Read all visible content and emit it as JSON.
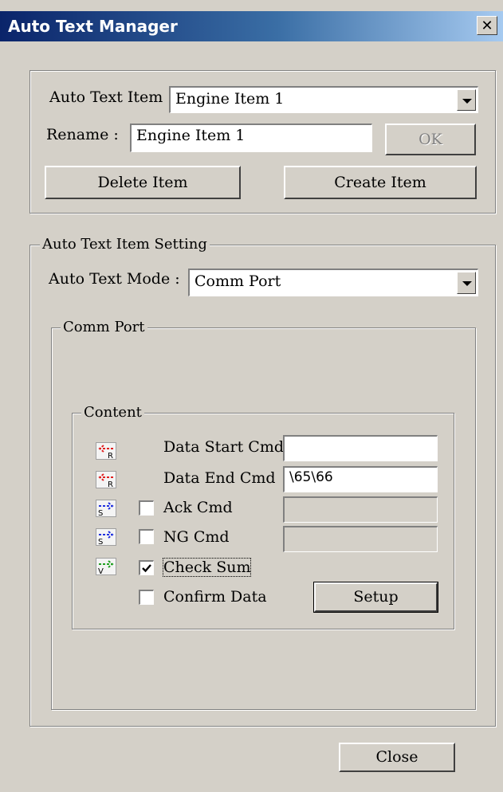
{
  "window": {
    "title": "Auto Text Manager",
    "close_glyph": "✕"
  },
  "item_group": {
    "item_label": "Auto Text Item",
    "item_selected": "Engine Item 1",
    "rename_label": "Rename :",
    "rename_value": "Engine Item 1",
    "ok_label": "OK",
    "delete_label": "Delete Item",
    "create_label": "Create Item"
  },
  "setting_group": {
    "title": "Auto Text Item Setting",
    "mode_label": "Auto Text Mode :",
    "mode_selected": "Comm Port",
    "comm_port_title": "Comm Port",
    "content": {
      "title": "Content",
      "rows": [
        {
          "label": "Data Start Cmd",
          "value": "",
          "icon": "arrow-left-R-red-icon",
          "color": "#e02020"
        },
        {
          "label": "Data End Cmd",
          "value": "\\65\\66",
          "icon": "arrow-left-R-red-icon",
          "color": "#e02020"
        },
        {
          "label": "Ack Cmd",
          "value": "",
          "icon": "arrow-right-S-blue-icon",
          "color": "#2030e0",
          "checked": false
        },
        {
          "label": "NG Cmd",
          "value": "",
          "icon": "arrow-right-S-blue-icon",
          "color": "#2030e0",
          "checked": false
        },
        {
          "label": "Check Sum",
          "icon": "arrow-right-V-green-icon",
          "color": "#20a020",
          "checked": true
        },
        {
          "label": "Confirm Data",
          "checked": false
        }
      ],
      "setup_label": "Setup"
    }
  },
  "footer": {
    "close_label": "Close"
  }
}
